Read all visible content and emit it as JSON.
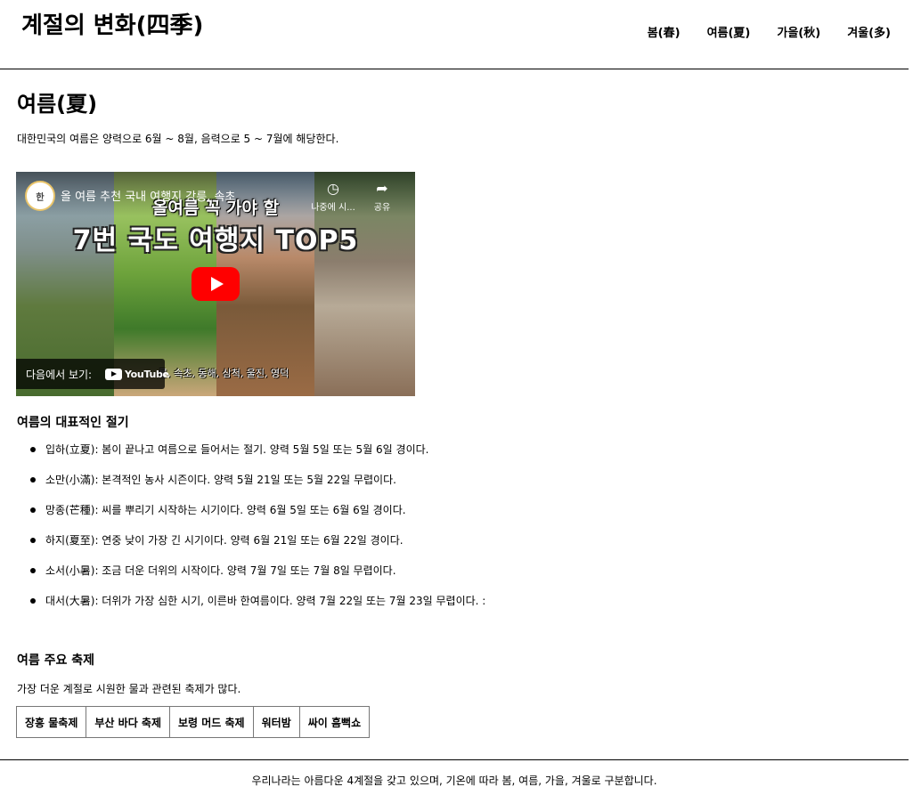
{
  "header": {
    "title": "계절의 변화(四季)",
    "nav": [
      "봄(春)",
      "여름(夏)",
      "가을(秋)",
      "겨울(多)"
    ]
  },
  "main": {
    "section_title": "여름(夏)",
    "intro": "대한민국의 여름은 양력으로 6월 ~ 8월, 음력으로 5 ~ 7월에 해당한다.",
    "video": {
      "channel_avatar": "한",
      "title": "올 여름 추천 국내 여행지 강릉, 속초",
      "watch_later_label": "나중에 시...",
      "share_label": "공유",
      "banner_line1": "올여름 꼭 가야 할",
      "banner_line2": "7번 국도 여행지 TOP5",
      "watch_on_label": "다음에서 보기:",
      "youtube_label": "YouTube",
      "caption": "릉, 속초, 동해, 삼척, 울진, 영덕"
    },
    "solar_terms_title": "여름의 대표적인 절기",
    "solar_terms": [
      "입하(立夏): 봄이 끝나고 여름으로 들어서는 절기. 양력 5월 5일 또는 5월 6일 경이다.",
      "소만(小滿): 본격적인 농사 시즌이다. 양력 5월 21일 또는 5월 22일 무렵이다.",
      "망종(芒種): 씨를 뿌리기 시작하는 시기이다. 양력 6월 5일 또는 6월 6일 경이다.",
      "하지(夏至): 연중 낮이 가장 긴 시기이다. 양력 6월 21일 또는 6월 22일 경이다.",
      "소서(小暑): 조금 더운 더위의 시작이다. 양력 7월 7일 또는 7월 8일 무렵이다.",
      "대서(大暑): 더위가 가장 심한 시기, 이른바 한여름이다. 양력 7월 22일 또는 7월 23일 무렵이다. :"
    ],
    "festivals_title": "여름 주요 축제",
    "festivals_desc": "가장 더운 계절로 시원한 물과 관련된 축제가 많다.",
    "festivals": [
      "장흥 물축제",
      "부산 바다 축제",
      "보령 머드 축제",
      "워터밤",
      "싸이 흠뻑쇼"
    ]
  },
  "footer": {
    "text": "우리나라는 아름다운 4계절을 갖고 있으며, 기온에 따라 봄, 여름, 가을, 겨울로 구분합니다."
  },
  "icons": {
    "watch_later": "clock-icon",
    "share": "share-arrow-icon",
    "play": "youtube-play-icon"
  },
  "colors": {
    "youtube_red": "#ff0000"
  }
}
